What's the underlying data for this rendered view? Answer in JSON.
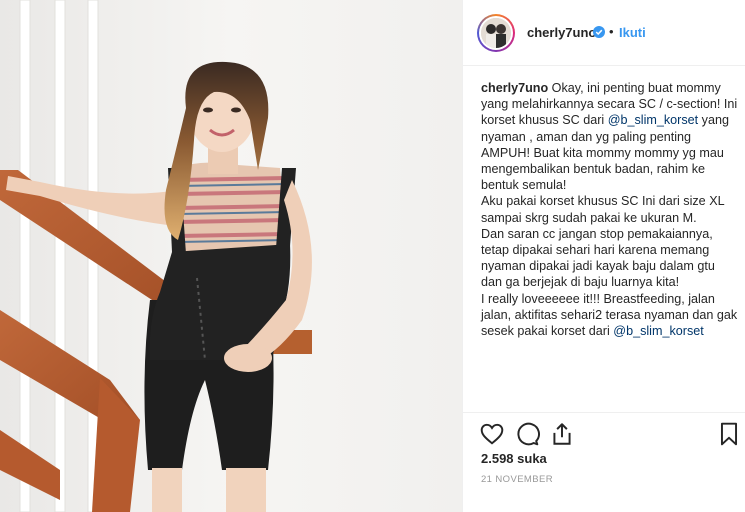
{
  "post": {
    "author": {
      "username": "cherly7uno",
      "separator": "•",
      "follow_label": "Ikuti"
    },
    "caption": {
      "username": "cherly7uno",
      "line1_a": " Okay, ini penting buat mommy yang melahirkannya secara SC / c-section! Ini korset khusus SC dari ",
      "mention1": "@b_slim_korset",
      "line1_b": " yang nyaman , aman dan yg paling penting AMPUH! Buat kita mommy mommy yg mau mengembalikan bentuk badan, rahim ke bentuk semula!",
      "line2": "Aku pakai korset khusus SC Ini dari size XL sampai skrg sudah pakai ke ukuran M.",
      "line3": "Dan saran cc jangan stop pemakaiannya, tetap dipakai sehari hari karena memang nyaman dipakai jadi kayak baju dalam gtu dan ga berjejak di baju luarnya kita!",
      "line4": "I really loveeeeee it!!! Breastfeeding, jalan jalan, aktifitas sehari2 terasa nyaman dan gak sesek pakai korset dari ",
      "mention2": "@b_slim_korset"
    },
    "likes": "2.598 suka",
    "date": "21 NOVEMBER",
    "icons": {
      "like": "heart-icon",
      "comment": "comment-icon",
      "share": "share-icon",
      "save": "bookmark-icon",
      "verified": "verified-badge-icon"
    },
    "colors": {
      "follow": "#3897f0",
      "mention": "#003569",
      "verified": "#3897f0"
    }
  }
}
